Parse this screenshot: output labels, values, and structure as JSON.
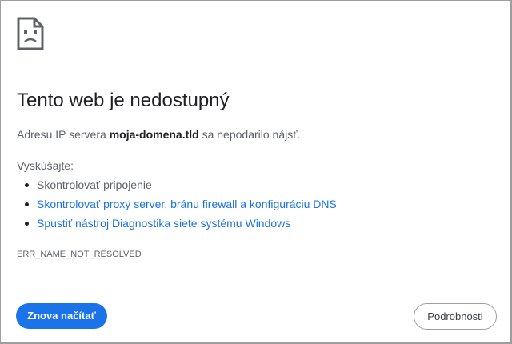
{
  "error_page": {
    "icon": "sad-page-icon",
    "title": "Tento web je nedostupný",
    "description": {
      "prefix": "Adresu IP servera ",
      "domain": "moja-domena.tld",
      "suffix": " sa nepodarilo nájsť."
    },
    "try_label": "Vyskúšajte:",
    "suggestions": [
      "Skontrolovať pripojenie",
      "Skontrolovať proxy server, bránu firewall a konfiguráciu DNS",
      "Spustiť nástroj Diagnostika siete systému Windows"
    ],
    "error_code": "ERR_NAME_NOT_RESOLVED",
    "reload_label": "Znova načítať",
    "details_label": "Podrobnosti",
    "colors": {
      "accent": "#1a73e8",
      "title": "#202124",
      "secondary_text": "#5f6368",
      "border": "#9e9e9e"
    }
  }
}
